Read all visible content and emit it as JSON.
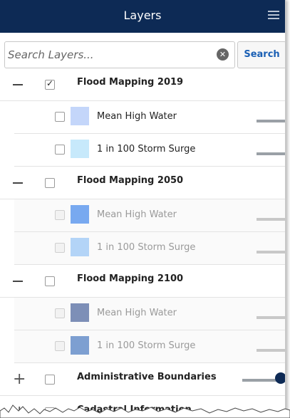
{
  "header": {
    "title": "Layers"
  },
  "search": {
    "placeholder": "Search Layers...",
    "button_label": "Search"
  },
  "groups": [
    {
      "label": "Flood Mapping 2019",
      "checked": true,
      "expanded": true,
      "children": [
        {
          "label": "Mean High Water",
          "swatch": "#c4d6fa"
        },
        {
          "label": "1 in 100 Storm Surge",
          "swatch": "#c7e9fb"
        }
      ]
    },
    {
      "label": "Flood Mapping 2050",
      "checked": false,
      "expanded": true,
      "children": [
        {
          "label": "Mean High Water",
          "swatch": "#78a9f0"
        },
        {
          "label": "1 in 100 Storm Surge",
          "swatch": "#b3d4f7"
        }
      ]
    },
    {
      "label": "Flood Mapping 2100",
      "checked": false,
      "expanded": true,
      "children": [
        {
          "label": "Mean High Water",
          "swatch": "#7d8fb7"
        },
        {
          "label": "1 in 100 Storm Surge",
          "swatch": "#7d9fd1"
        }
      ]
    },
    {
      "label": "Administrative Boundaries",
      "checked": false,
      "expanded": false
    },
    {
      "label": "Cadastral Information",
      "checked": false,
      "expanded": false
    }
  ]
}
